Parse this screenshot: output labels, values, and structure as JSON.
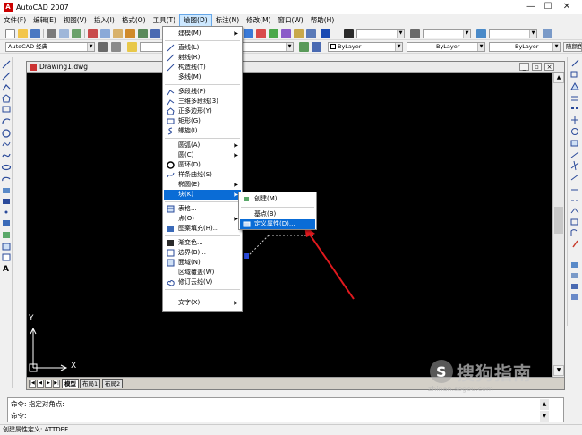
{
  "titlebar": {
    "title": "AutoCAD 2007",
    "minimize": "—",
    "maximize": "☐",
    "close": "✕"
  },
  "menubar": {
    "items": [
      {
        "label": "文件(F)"
      },
      {
        "label": "编辑(E)"
      },
      {
        "label": "视图(V)"
      },
      {
        "label": "插入(I)"
      },
      {
        "label": "格式(O)"
      },
      {
        "label": "工具(T)"
      },
      {
        "label": "绘图(D)",
        "active": true
      },
      {
        "label": "标注(N)"
      },
      {
        "label": "修改(M)"
      },
      {
        "label": "窗口(W)"
      },
      {
        "label": "帮助(H)"
      }
    ]
  },
  "toolbar": {
    "workspace": "AutoCAD 经典",
    "color": "ByLayer",
    "linetype": "ByLayer",
    "lineweight": "ByLayer",
    "plotstyle": "随颜色"
  },
  "document": {
    "title": "Drawing1.dwg"
  },
  "ucs": {
    "x_label": "X",
    "y_label": "Y"
  },
  "layout_tabs": [
    "模型",
    "布局1",
    "布局2"
  ],
  "draw_menu": {
    "items": [
      {
        "label": "建模(M)",
        "submenu": true
      },
      {
        "label": "直线(L)"
      },
      {
        "label": "射线(R)"
      },
      {
        "label": "构造线(T)"
      },
      {
        "label": "多线(M)"
      },
      {
        "label": "多段线(P)"
      },
      {
        "label": "三维多段线(3)"
      },
      {
        "label": "正多边形(Y)"
      },
      {
        "label": "矩形(G)"
      },
      {
        "label": "螺旋(I)"
      },
      {
        "label": "圆弧(A)",
        "submenu": true
      },
      {
        "label": "圆(C)",
        "submenu": true
      },
      {
        "label": "圆环(D)"
      },
      {
        "label": "样条曲线(S)"
      },
      {
        "label": "椭圆(E)",
        "submenu": true
      },
      {
        "label": "块(K)",
        "submenu": true,
        "highlighted": true
      },
      {
        "label": "表格..."
      },
      {
        "label": "点(O)",
        "submenu": true
      },
      {
        "label": "图案填充(H)..."
      },
      {
        "label": "渐变色..."
      },
      {
        "label": "边界(B)..."
      },
      {
        "label": "面域(N)"
      },
      {
        "label": "区域覆盖(W)"
      },
      {
        "label": "修订云线(V)"
      },
      {
        "label": "文字(X)",
        "submenu": true
      }
    ]
  },
  "block_submenu": {
    "items": [
      {
        "label": "创建(M)..."
      },
      {
        "label": "基点(B)"
      },
      {
        "label": "定义属性(D)...",
        "highlighted": true
      }
    ]
  },
  "command": {
    "history": "命令: 指定对角点:",
    "prompt": "命令:"
  },
  "status": {
    "text": "创建属性定义:  ATTDEF"
  },
  "watermark": {
    "text": "搜狗指南",
    "url": "zhinan.sogou.com"
  },
  "colors": {
    "canvas": "#000000",
    "highlight": "#0a6cd6",
    "arrow": "#e0191e"
  }
}
